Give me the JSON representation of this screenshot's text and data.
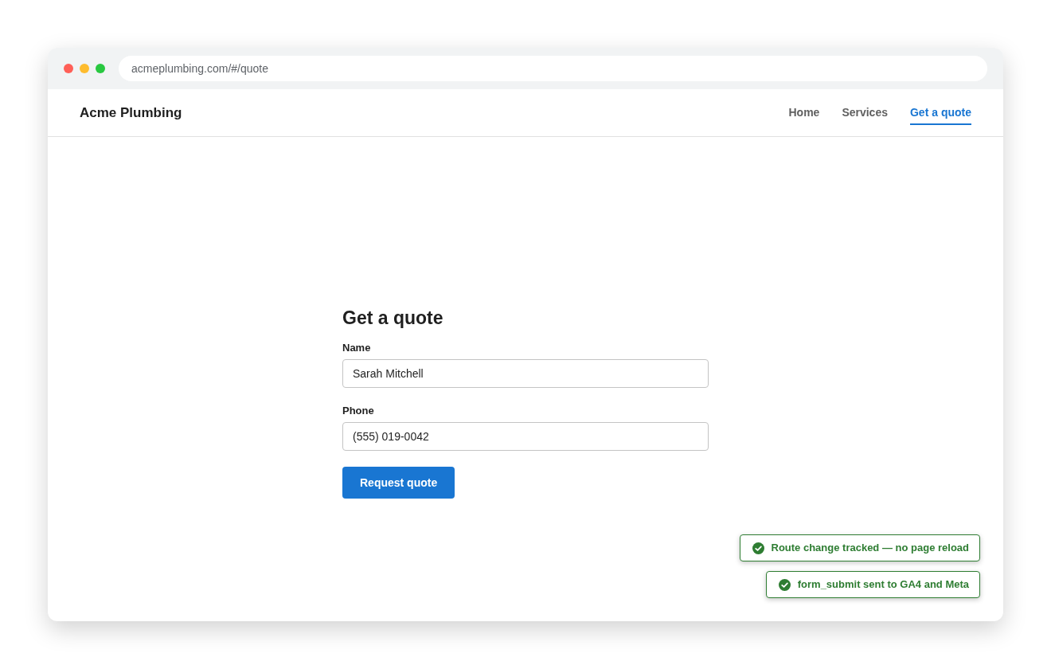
{
  "browser": {
    "url": "acmeplumbing.com/#/quote"
  },
  "site": {
    "logo": "Acme Plumbing",
    "nav": [
      {
        "label": "Home",
        "selected": false
      },
      {
        "label": "Services",
        "selected": false
      },
      {
        "label": "Get a quote",
        "selected": true
      }
    ]
  },
  "form": {
    "title": "Get a quote",
    "fields": [
      {
        "label": "Name",
        "value": "Sarah Mitchell"
      },
      {
        "label": "Phone",
        "value": "(555) 019-0042"
      }
    ],
    "submit": "Request quote"
  },
  "toasts": [
    {
      "text": "Route change tracked — no page reload"
    },
    {
      "text": "form_submit sent to GA4 and Meta"
    }
  ]
}
